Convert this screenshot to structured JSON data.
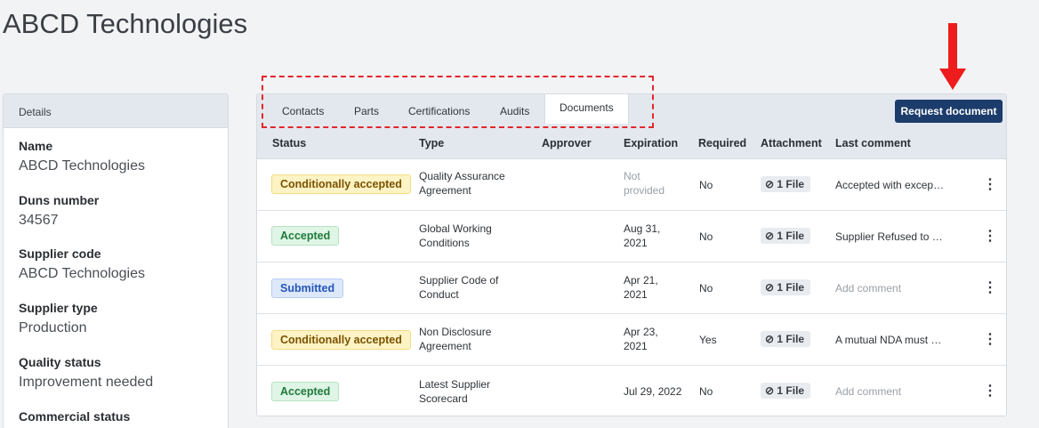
{
  "page": {
    "title": "ABCD Technologies"
  },
  "details": {
    "header": "Details",
    "fields": [
      {
        "label": "Name",
        "value": "ABCD Technologies"
      },
      {
        "label": "Duns number",
        "value": "34567"
      },
      {
        "label": "Supplier code",
        "value": "ABCD Technologies"
      },
      {
        "label": "Supplier type",
        "value": "Production"
      },
      {
        "label": "Quality status",
        "value": "Improvement needed"
      },
      {
        "label": "Commercial status",
        "value": ""
      }
    ]
  },
  "tabs": [
    "Contacts",
    "Parts",
    "Certifications",
    "Audits",
    "Documents"
  ],
  "active_tab": "Documents",
  "request_button": "Request document",
  "columns": [
    "Status",
    "Type",
    "Approver",
    "Expiration",
    "Required",
    "Attachment",
    "Last comment"
  ],
  "rows": [
    {
      "status": "Conditionally accepted",
      "status_kind": "cond",
      "type_line1": "Quality Assurance",
      "type_line2": "Agreement",
      "approver": "",
      "exp_line1": "Not",
      "exp_line2": "provided",
      "exp_muted": true,
      "required": "No",
      "attachment": "1 File",
      "comment": "Accepted with excep…",
      "comment_muted": false
    },
    {
      "status": "Accepted",
      "status_kind": "acc",
      "type_line1": "Global Working",
      "type_line2": "Conditions",
      "approver": "",
      "exp_line1": "Aug 31,",
      "exp_line2": "2021",
      "exp_muted": false,
      "required": "No",
      "attachment": "1 File",
      "comment": "Supplier Refused to …",
      "comment_muted": false
    },
    {
      "status": "Submitted",
      "status_kind": "sub",
      "type_line1": "Supplier Code of",
      "type_line2": "Conduct",
      "approver": "",
      "exp_line1": "Apr 21,",
      "exp_line2": "2021",
      "exp_muted": false,
      "required": "No",
      "attachment": "1 File",
      "comment": "Add comment",
      "comment_muted": true
    },
    {
      "status": "Conditionally accepted",
      "status_kind": "cond",
      "type_line1": "Non Disclosure",
      "type_line2": "Agreement",
      "approver": "",
      "exp_line1": "Apr 23,",
      "exp_line2": "2021",
      "exp_muted": false,
      "required": "Yes",
      "attachment": "1 File",
      "comment": "A mutual NDA must …",
      "comment_muted": false
    },
    {
      "status": "Accepted",
      "status_kind": "acc",
      "type_line1": "Latest Supplier",
      "type_line2": "Scorecard",
      "approver": "",
      "exp_line1": "Jul 29, 2022",
      "exp_line2": "",
      "exp_muted": false,
      "required": "No",
      "attachment": "1 File",
      "comment": "Add comment",
      "comment_muted": true
    }
  ],
  "icons": {
    "attachment": "paperclip-icon",
    "row_menu": "kebab-menu-icon"
  },
  "colors": {
    "primary_button": "#1c3c6b",
    "annotation": "#e3262b"
  }
}
